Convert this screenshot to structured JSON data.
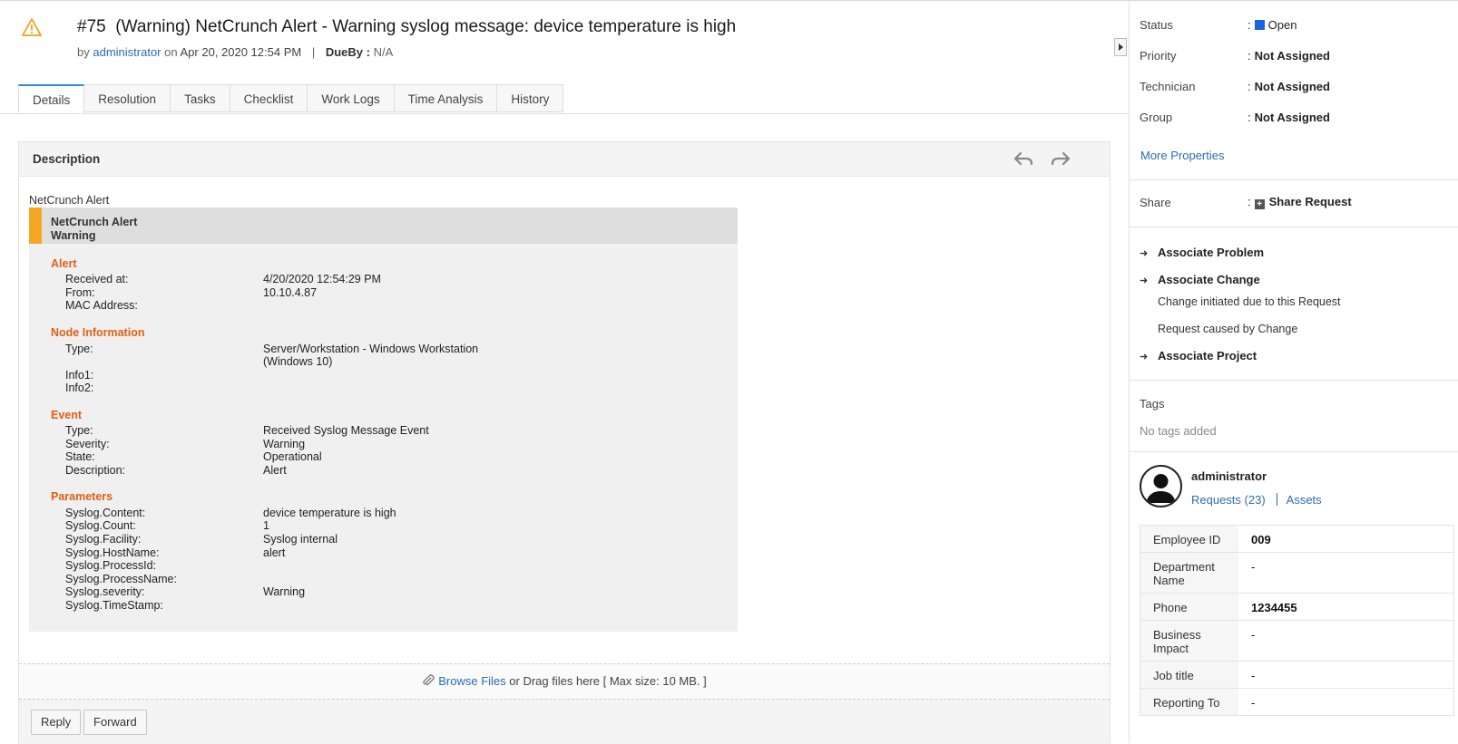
{
  "header": {
    "ticket_number": "#75",
    "subject": "(Warning) NetCrunch Alert - Warning syslog message: device temperature is high",
    "by_label": "by",
    "requester": "administrator",
    "on_label": "on",
    "created": "Apr 20, 2020 12:54 PM",
    "separator": "|",
    "dueby_label": "DueBy :",
    "dueby_value": "N/A"
  },
  "tabs": [
    "Details",
    "Resolution",
    "Tasks",
    "Checklist",
    "Work Logs",
    "Time Analysis",
    "History"
  ],
  "description": {
    "title": "Description",
    "top_text": "NetCrunch Alert",
    "alert_title": "NetCrunch Alert",
    "alert_level": "Warning",
    "sections": {
      "alert": {
        "title": "Alert",
        "rows": [
          {
            "k": "Received at:",
            "v": "4/20/2020 12:54:29 PM"
          },
          {
            "k": "From:",
            "v": "10.10.4.87"
          },
          {
            "k": "MAC Address:",
            "v": ""
          }
        ]
      },
      "node": {
        "title": "Node Information",
        "rows": [
          {
            "k": "Type:",
            "v": "Server/Workstation - Windows Workstation",
            "v2": "(Windows 10)"
          },
          {
            "k": "Info1:",
            "v": ""
          },
          {
            "k": "Info2:",
            "v": ""
          }
        ]
      },
      "event": {
        "title": "Event",
        "rows": [
          {
            "k": "Type:",
            "v": "Received Syslog Message Event"
          },
          {
            "k": "Severity:",
            "v": "Warning"
          },
          {
            "k": "State:",
            "v": "Operational"
          },
          {
            "k": "Description:",
            "v": "Alert"
          }
        ]
      },
      "params": {
        "title": "Parameters",
        "rows": [
          {
            "k": "Syslog.Content:",
            "v": "device temperature is high"
          },
          {
            "k": "Syslog.Count:",
            "v": "1"
          },
          {
            "k": "Syslog.Facility:",
            "v": "Syslog internal"
          },
          {
            "k": "Syslog.HostName:",
            "v": "alert"
          },
          {
            "k": "Syslog.ProcessId:",
            "v": ""
          },
          {
            "k": "Syslog.ProcessName:",
            "v": ""
          },
          {
            "k": "Syslog.severity:",
            "v": "Warning"
          },
          {
            "k": "Syslog.TimeStamp:",
            "v": ""
          }
        ]
      }
    },
    "attach_link": "Browse Files",
    "attach_text": "or Drag files here [ Max size: 10 MB. ]",
    "reply_label": "Reply",
    "forward_label": "Forward"
  },
  "sidebar": {
    "status_label": "Status",
    "status_value": "Open",
    "priority_label": "Priority",
    "priority_value": "Not Assigned",
    "technician_label": "Technician",
    "technician_value": "Not Assigned",
    "group_label": "Group",
    "group_value": "Not Assigned",
    "colon": ":",
    "more_properties": "More Properties",
    "share_label": "Share",
    "share_value": "Share Request",
    "associate_problem": "Associate Problem",
    "associate_change": "Associate Change",
    "change_initiated": "Change initiated due to this Request",
    "request_caused": "Request caused by Change",
    "associate_project": "Associate Project",
    "tags_title": "Tags",
    "tags_none": "No tags added",
    "user_name": "administrator",
    "requests_link": "Requests (23)",
    "assets_link": "Assets",
    "info": [
      {
        "k": "Employee ID",
        "v": "009"
      },
      {
        "k": "Department Name",
        "v": "-"
      },
      {
        "k": "Phone",
        "v": "1234455"
      },
      {
        "k": "Business Impact",
        "v": "-"
      },
      {
        "k": "Job title",
        "v": "-"
      },
      {
        "k": "Reporting To",
        "v": "-"
      }
    ]
  },
  "colors": {
    "accent_blue": "#2b8de8",
    "link_blue": "#2b6cb0",
    "status_blue": "#1a64e3",
    "warning_orange": "#f5a623",
    "section_orange": "#e06014"
  }
}
